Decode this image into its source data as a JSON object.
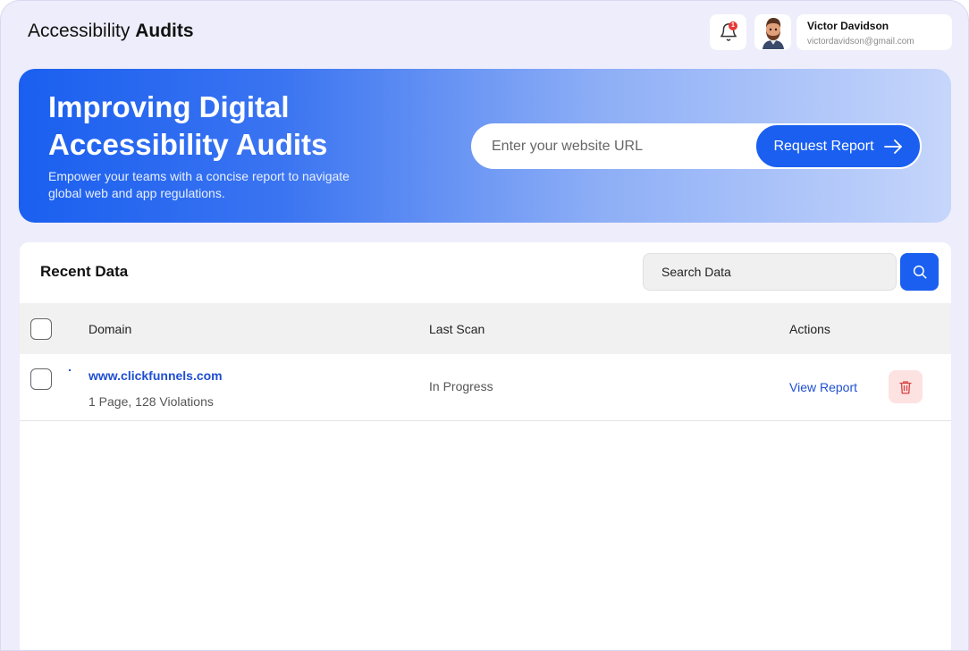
{
  "header": {
    "title_regular": "Accessibility",
    "title_bold": "Audits",
    "notification_count": "1",
    "user": {
      "name": "Victor Davidson",
      "email": "victordavidson@gmail.com"
    }
  },
  "hero": {
    "title": "Improving Digital Accessibility Audits",
    "subtitle": "Empower your teams with a concise report to navigate global web and app regulations.",
    "url_placeholder": "Enter your website URL",
    "request_button": "Request Report"
  },
  "recent": {
    "title": "Recent Data",
    "search_placeholder": "Search Data",
    "columns": [
      "Domain",
      "Last Scan",
      "Actions"
    ],
    "rows": [
      {
        "domain": "www.clickfunnels.com",
        "meta": "1 Page, 128 Violations",
        "status": "In Progress",
        "action": "View Report"
      }
    ]
  },
  "colors": {
    "accent": "#1a5ff0",
    "link": "#1f4fd1",
    "badge": "#e53935",
    "delete_bg": "#fde2e2",
    "delete_icon": "#d64545"
  }
}
